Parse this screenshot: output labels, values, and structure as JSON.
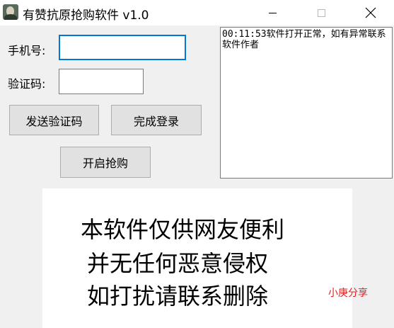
{
  "window": {
    "title": "有赞抗原抢购软件 v1.0",
    "icon": "app-avatar-icon"
  },
  "form": {
    "phone_label": "手机号:",
    "phone_value": "",
    "code_label": "验证码:",
    "code_value": "",
    "send_code_label": "发送验证码",
    "login_label": "完成登录",
    "start_grab_label": "开启抢购"
  },
  "log": {
    "text": "00:11:53软件打开正常，如有异常联系软件作者"
  },
  "notice": {
    "lines": [
      "本软件仅供网友便利",
      "并无任何恶意侵权",
      "如打扰请联系删除"
    ]
  },
  "watermark": {
    "text": "小庚分享",
    "color": "#e02020"
  },
  "colors": {
    "focus_border": "#0078d7",
    "window_bg": "#f0f0f0",
    "button_bg": "#e1e1e1"
  }
}
